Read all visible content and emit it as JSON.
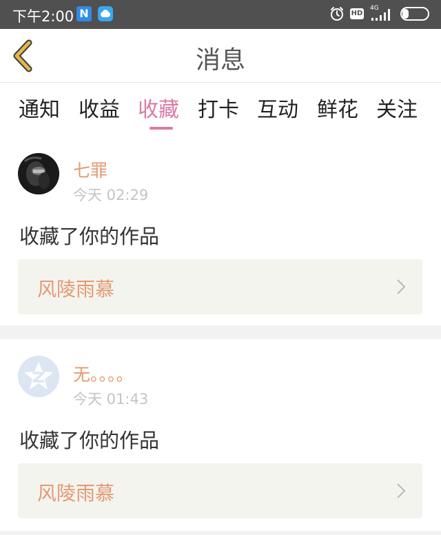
{
  "status_bar": {
    "time": "下午2:00",
    "app1_letter": "N",
    "network": "4G",
    "battery": "26",
    "battery_level": 0.26,
    "icons": [
      "nfc-app-icon",
      "cloud-app-icon",
      "alarm-icon",
      "hd-icon",
      "signal-icon",
      "battery-icon"
    ],
    "hd": "HD"
  },
  "header": {
    "title": "消息",
    "back_icon": "chevron-left-icon",
    "accent_color": "#e3b84a"
  },
  "tabs": [
    {
      "label": "通知"
    },
    {
      "label": "收益"
    },
    {
      "label": "收藏"
    },
    {
      "label": "打卡"
    },
    {
      "label": "互动"
    },
    {
      "label": "鲜花"
    },
    {
      "label": "关注"
    }
  ],
  "active_tab": "收藏",
  "colors": {
    "active_tab": "#d97aa3",
    "username": "#e39a72",
    "timestamp": "#c4c4c4",
    "work_box_bg": "#f4f4ef"
  },
  "messages": [
    {
      "username": "七罪",
      "time": "今天 02:29",
      "action": "收藏了你的作品",
      "work_title": "风陵雨慕"
    },
    {
      "username": "无。。。。",
      "time": "今天 01:43",
      "action": "收藏了你的作品",
      "work_title": "风陵雨慕"
    }
  ]
}
